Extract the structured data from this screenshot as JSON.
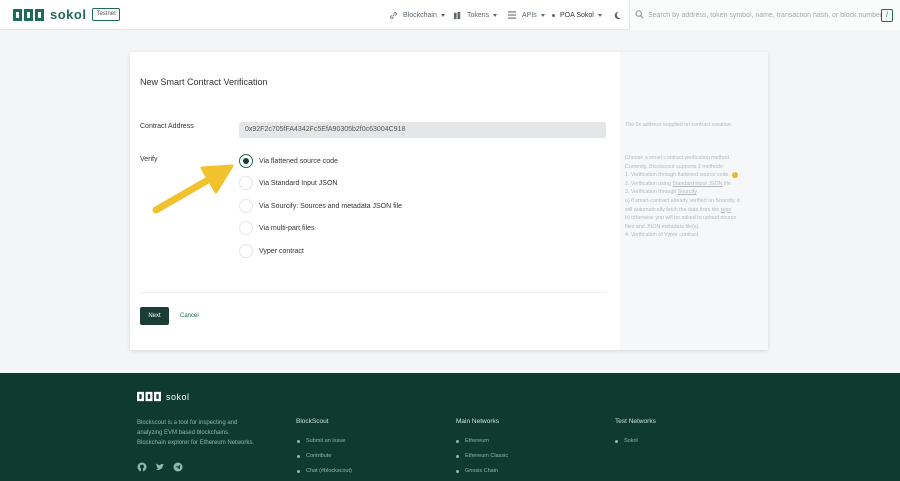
{
  "header": {
    "brand": "sokol",
    "badge": "Testnet",
    "nav": {
      "blockchain": "Blockchain",
      "tokens": "Tokens",
      "apis": "APIs",
      "network": "POA Sokol"
    },
    "search": {
      "placeholder": "Search by address, token symbol, name, transaction hash, or block number",
      "shortcut": "/"
    },
    "icons": [
      "link-icon",
      "tokens-icon",
      "menu-icon",
      "dot-icon",
      "moon-icon",
      "search-icon"
    ]
  },
  "form": {
    "title": "New Smart Contract Verification",
    "address_label": "Contract Address",
    "address_value": "0x92F2c705fFA4342Fc5EfA90305b2f0c63004C918",
    "verify_label": "Verify",
    "options": [
      {
        "label": "Via flattened source code",
        "checked": true
      },
      {
        "label": "Via Standard Input JSON",
        "checked": false
      },
      {
        "label": "Via Sourcify: Sources and metadata JSON file",
        "checked": false
      },
      {
        "label": "Via multi-part files",
        "checked": false
      },
      {
        "label": "Vyper contract",
        "checked": false
      }
    ],
    "next_button": "Next",
    "cancel_button": "Cancel"
  },
  "help": {
    "address_hint": "The 0x address supplied on contract creation.",
    "methods_intro": "Choose a smart-contract verification method. Currently, Blockscout supports 2 methods:",
    "m1": "1. Verification through flattened source code.",
    "m2_prefix": "2. Verification using ",
    "m2_link": "Standard input JSON",
    "m2_suffix": " file.",
    "m3_prefix": "3. Verification through ",
    "m3_link": "Sourcify",
    "m3_suffix": ".",
    "m3a_prefix": "a) if smart-contract already verified on Sourcify, it will automatically fetch the data from the ",
    "m3a_link": "repo",
    "m3b": "b) otherwise you will be asked to upload source files and JSON metadata file(s).",
    "m4": "4. Verification of Vyper contract."
  },
  "footer": {
    "brand": "sokol",
    "about": "Blockscout is a tool for inspecting and analyzing EVM based blockchains. Blockchain explorer for Ethereum Networks.",
    "columns": [
      {
        "title": "BlockScout",
        "links": [
          "Submit an Issue",
          "Contribute",
          "Chat (#blockscout)"
        ]
      },
      {
        "title": "Main Networks",
        "links": [
          "Ethereum",
          "Ethereum Classic",
          "Gnosis Chain"
        ]
      },
      {
        "title": "Test Networks",
        "links": [
          "Sokol"
        ]
      }
    ],
    "social_icons": [
      "github-icon",
      "twitter-icon",
      "telegram-icon"
    ]
  },
  "colors": {
    "brand": "#1f6b5b",
    "button": "#1c3d35",
    "footer_bg": "#0e3a30",
    "arrow": "#f2c12e"
  }
}
